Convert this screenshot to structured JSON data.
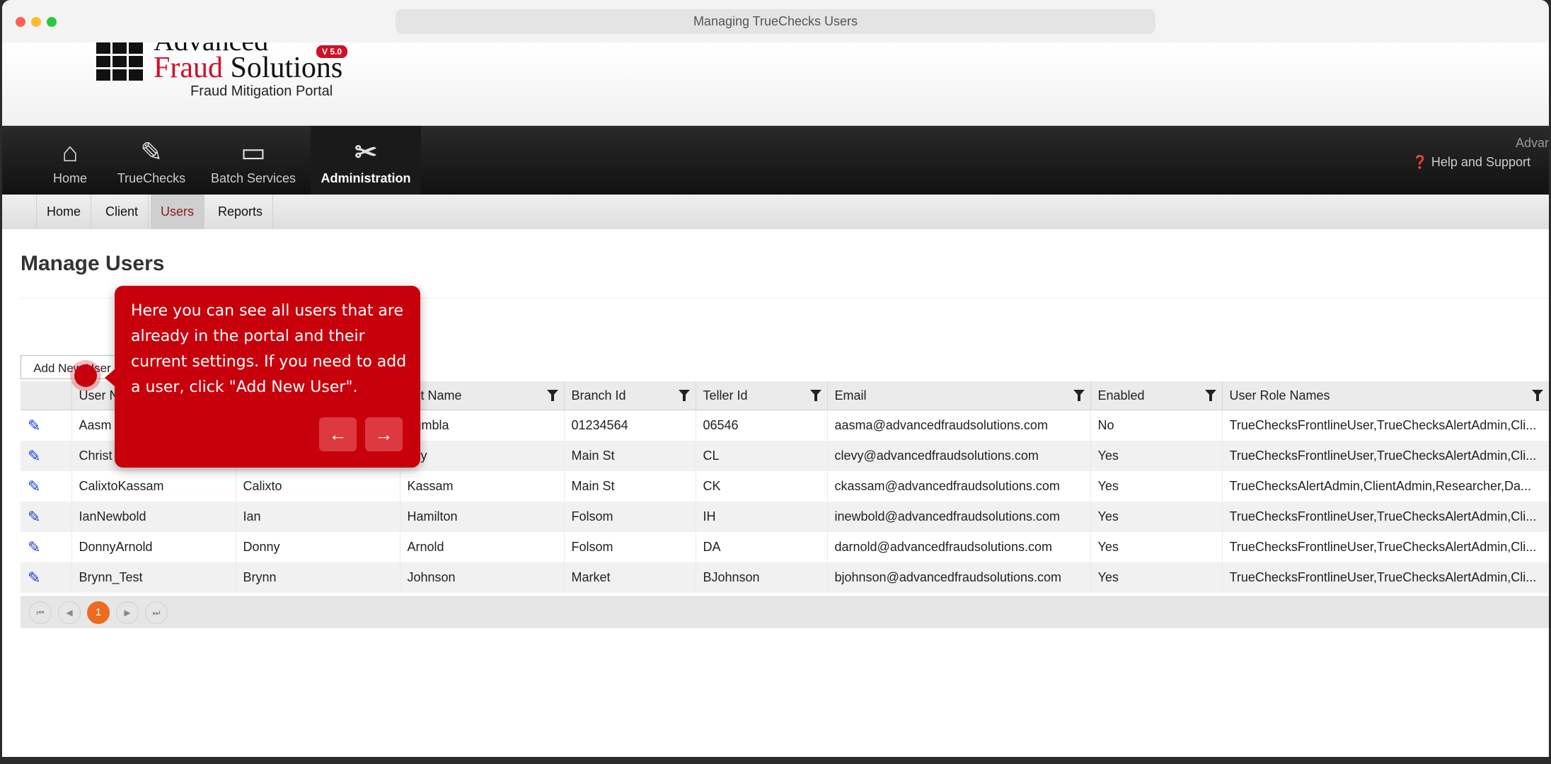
{
  "window": {
    "title": "Managing TrueChecks Users"
  },
  "header": {
    "logo_top": "Advanced",
    "logo_fraud": "Fraud",
    "logo_solutions": " Solutions",
    "logo_sub": "Fraud Mitigation Portal",
    "version": "V 5.0"
  },
  "nav": {
    "items": [
      {
        "label": "Home",
        "icon": "home-icon"
      },
      {
        "label": "TrueChecks",
        "icon": "check-pen-icon"
      },
      {
        "label": "Batch Services",
        "icon": "inbox-tray-icon"
      },
      {
        "label": "Administration",
        "icon": "tools-icon",
        "active": true
      }
    ],
    "right_top": "Advar",
    "help": "Help and Support"
  },
  "subnav": {
    "items": [
      "Home",
      "Client",
      "Users",
      "Reports"
    ],
    "active": "Users"
  },
  "page": {
    "title": "Manage Users",
    "add_button": "Add New User"
  },
  "grid": {
    "columns": [
      "",
      "User N",
      "",
      "ast Name",
      "Branch Id",
      "Teller Id",
      "Email",
      "Enabled",
      "User Role Names"
    ],
    "rows": [
      [
        "",
        "Aasm",
        "",
        "humbla",
        "01234564",
        "06546",
        "aasma@advancedfraudsolutions.com",
        "No",
        "TrueChecksFrontlineUser,TrueChecksAlertAdmin,Cli..."
      ],
      [
        "",
        "Christ",
        "",
        "evy",
        "Main St",
        "CL",
        "clevy@advancedfraudsolutions.com",
        "Yes",
        "TrueChecksFrontlineUser,TrueChecksAlertAdmin,Cli..."
      ],
      [
        "",
        "CalixtoKassam",
        "Calixto",
        "Kassam",
        "Main St",
        "CK",
        "ckassam@advancedfraudsolutions.com",
        "Yes",
        "TrueChecksAlertAdmin,ClientAdmin,Researcher,Da..."
      ],
      [
        "",
        "IanNewbold",
        "Ian",
        "Hamilton",
        "Folsom",
        "IH",
        "inewbold@advancedfraudsolutions.com",
        "Yes",
        "TrueChecksFrontlineUser,TrueChecksAlertAdmin,Cli..."
      ],
      [
        "",
        "DonnyArnold",
        "Donny",
        "Arnold",
        "Folsom",
        "DA",
        "darnold@advancedfraudsolutions.com",
        "Yes",
        "TrueChecksFrontlineUser,TrueChecksAlertAdmin,Cli..."
      ],
      [
        "",
        "Brynn_Test",
        "Brynn",
        "Johnson",
        "Market",
        "BJohnson",
        "bjohnson@advancedfraudsolutions.com",
        "Yes",
        "TrueChecksFrontlineUser,TrueChecksAlertAdmin,Cli..."
      ]
    ]
  },
  "pager": {
    "current_page": "1"
  },
  "tooltip": {
    "text": "Here you can see all users that are already in the portal and their current settings. If you need to add a user, click \"Add New User\".",
    "prev": "←",
    "next": "→"
  }
}
